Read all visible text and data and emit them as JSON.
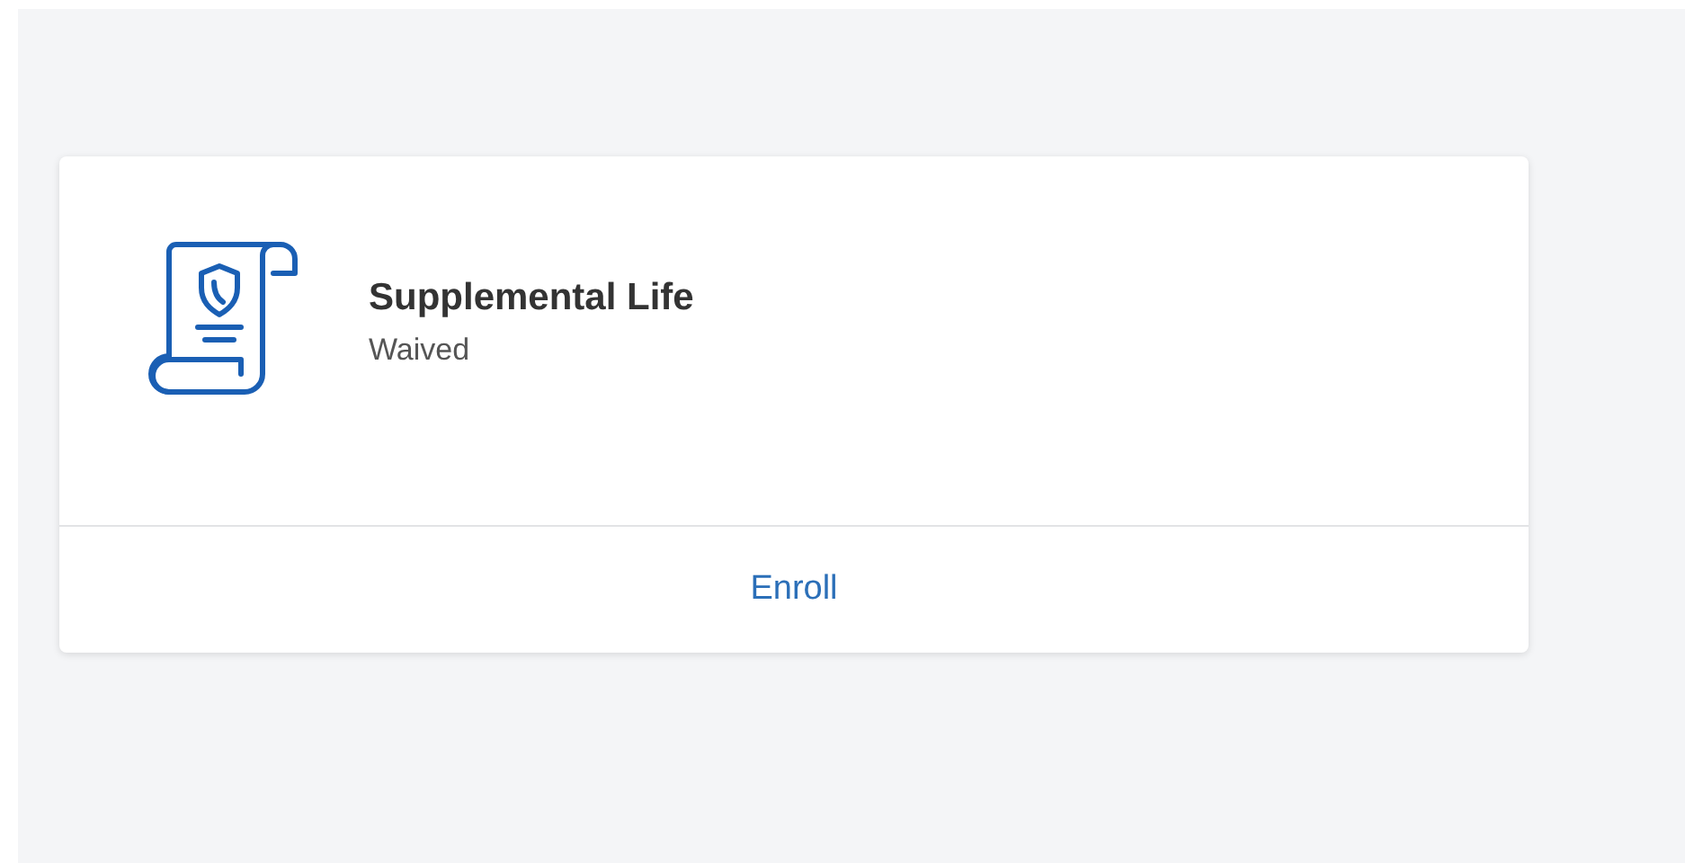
{
  "card": {
    "title": "Supplemental Life",
    "status": "Waived",
    "action": "Enroll"
  }
}
